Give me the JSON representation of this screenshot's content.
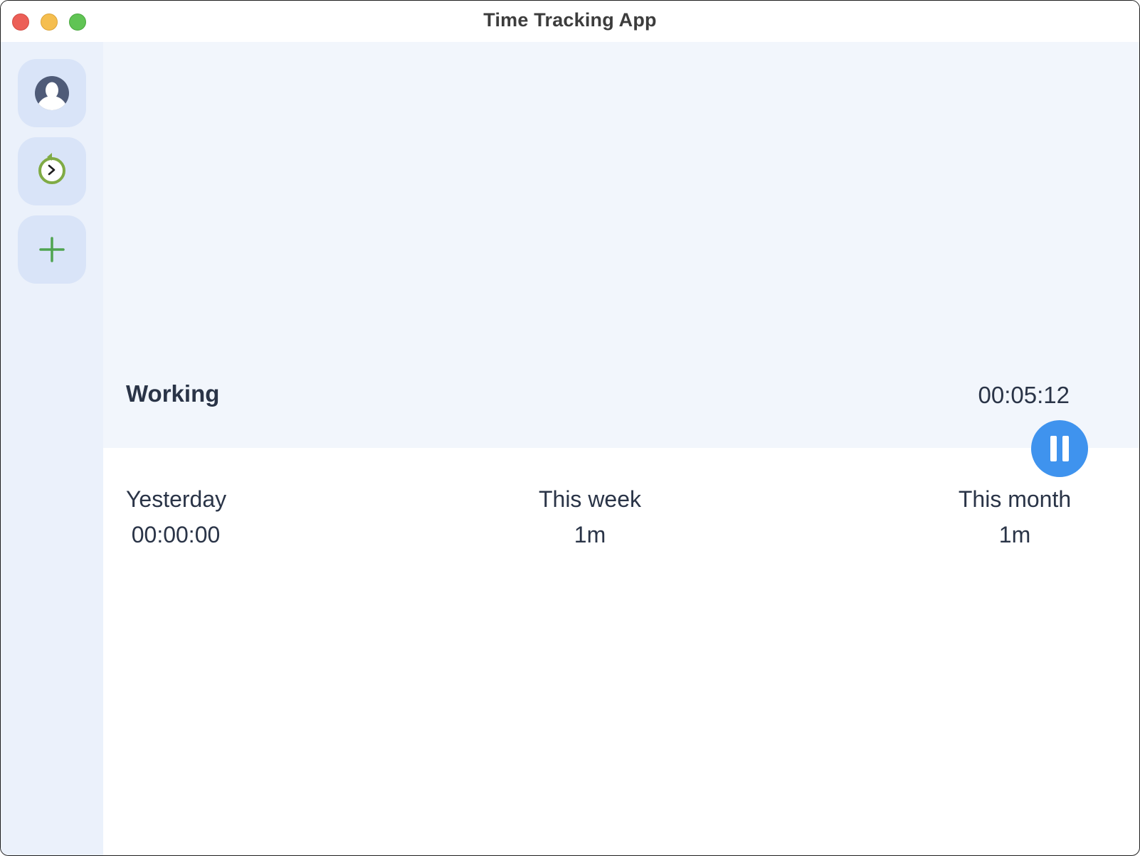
{
  "window": {
    "title": "Time Tracking App",
    "controls": [
      "close",
      "minimize",
      "maximize"
    ]
  },
  "sidebar": {
    "items": [
      {
        "name": "profile",
        "icon": "user-avatar-icon"
      },
      {
        "name": "history",
        "icon": "timer-history-icon"
      },
      {
        "name": "add",
        "icon": "plus-icon"
      }
    ]
  },
  "tracker": {
    "status": "Working",
    "elapsed": "00:05:12",
    "action_icon": "pause-icon"
  },
  "stats": [
    {
      "label": "Yesterday",
      "value": "00:00:00"
    },
    {
      "label": "This week",
      "value": "1m"
    },
    {
      "label": "This month",
      "value": "1m"
    }
  ],
  "colors": {
    "accent": "#3f93ee",
    "sidebar_bg": "#ebf1fb",
    "sidebar_button": "#d9e4f8",
    "panel_bg": "#f2f6fc",
    "text": "#2a3447",
    "icon_green": "#4fa350"
  }
}
